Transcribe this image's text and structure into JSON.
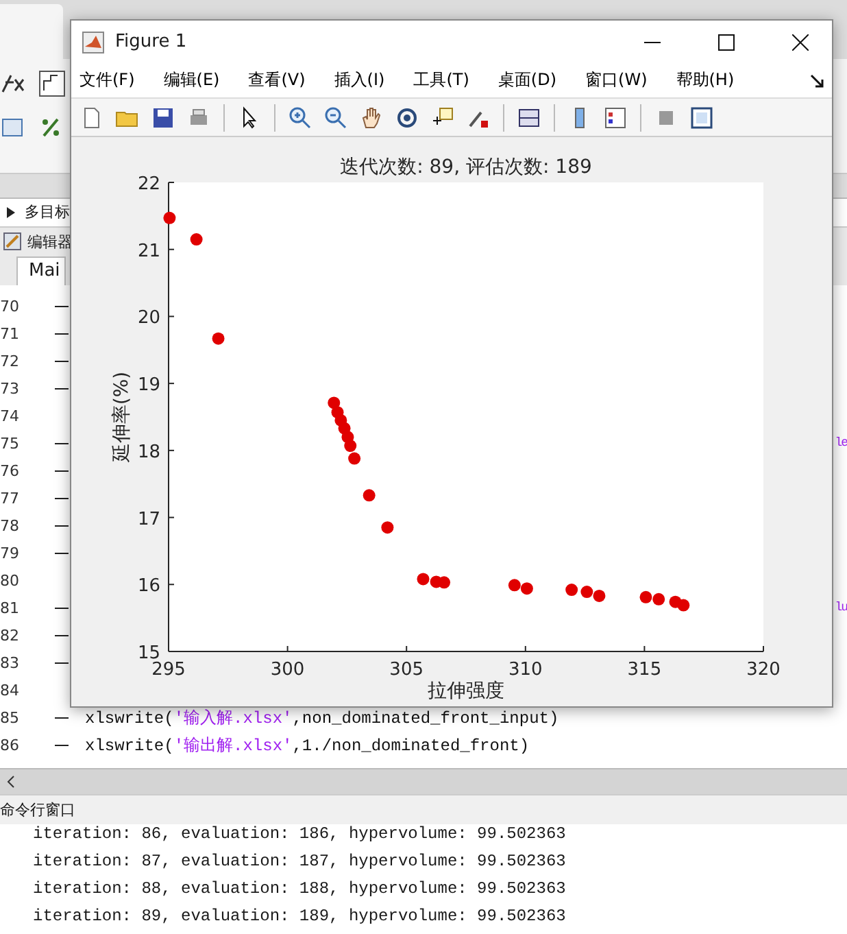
{
  "desktop": {
    "breadcrumb": "多目标",
    "editor_title": "编辑器",
    "editor_tab": "Mai",
    "editor_lines": [
      {
        "number": "70",
        "executable": true
      },
      {
        "number": "71",
        "executable": true
      },
      {
        "number": "72",
        "executable": true
      },
      {
        "number": "73",
        "executable": true
      },
      {
        "number": "74",
        "executable": false
      },
      {
        "number": "75",
        "executable": true,
        "tail": "le"
      },
      {
        "number": "76",
        "executable": true
      },
      {
        "number": "77",
        "executable": true
      },
      {
        "number": "78",
        "executable": true
      },
      {
        "number": "79",
        "executable": true
      },
      {
        "number": "80",
        "executable": false
      },
      {
        "number": "81",
        "executable": true,
        "tail": "lu"
      },
      {
        "number": "82",
        "executable": true
      },
      {
        "number": "83",
        "executable": true
      },
      {
        "number": "84",
        "executable": false
      },
      {
        "number": "85",
        "executable": true,
        "code": "xlswrite('输入解.xlsx',non_dominated_front_input)"
      },
      {
        "number": "86",
        "executable": true,
        "code": "xlswrite('输出解.xlsx',1./non_dominated_front)"
      }
    ],
    "command_window": {
      "title": "命令行窗口",
      "lines": [
        "iteration: 86, evaluation: 186, hypervolume: 99.502363",
        "iteration: 87, evaluation: 187, hypervolume: 99.502363",
        "iteration: 88, evaluation: 188, hypervolume: 99.502363",
        "iteration: 89, evaluation: 189, hypervolume: 99.502363"
      ]
    }
  },
  "figure_window": {
    "title": "Figure 1",
    "menu": [
      "文件(F)",
      "编辑(E)",
      "查看(V)",
      "插入(I)",
      "工具(T)",
      "桌面(D)",
      "窗口(W)",
      "帮助(H)"
    ],
    "chart_data": {
      "type": "scatter",
      "title": "迭代次数: 89, 评估次数: 189",
      "xlabel": "拉伸强度",
      "ylabel": "延伸率(%)",
      "xlim": [
        295,
        320
      ],
      "ylim": [
        15,
        22
      ],
      "xticks": [
        295,
        300,
        305,
        310,
        315,
        320
      ],
      "yticks": [
        15,
        16,
        17,
        18,
        19,
        20,
        21,
        22
      ],
      "series": [
        {
          "color": "#e00000",
          "x": [
            295.04,
            296.17,
            297.09,
            301.95,
            302.1,
            302.24,
            302.39,
            302.53,
            302.64,
            302.81,
            303.43,
            304.2,
            305.7,
            306.25,
            306.58,
            309.54,
            310.06,
            311.94,
            312.58,
            313.1,
            315.06,
            315.6,
            316.3,
            316.64
          ],
          "values": [
            21.47,
            21.15,
            19.67,
            18.71,
            18.57,
            18.45,
            18.33,
            18.2,
            18.07,
            17.88,
            17.33,
            16.85,
            16.08,
            16.04,
            16.03,
            15.99,
            15.94,
            15.92,
            15.89,
            15.83,
            15.81,
            15.78,
            15.74,
            15.69
          ]
        }
      ]
    }
  }
}
